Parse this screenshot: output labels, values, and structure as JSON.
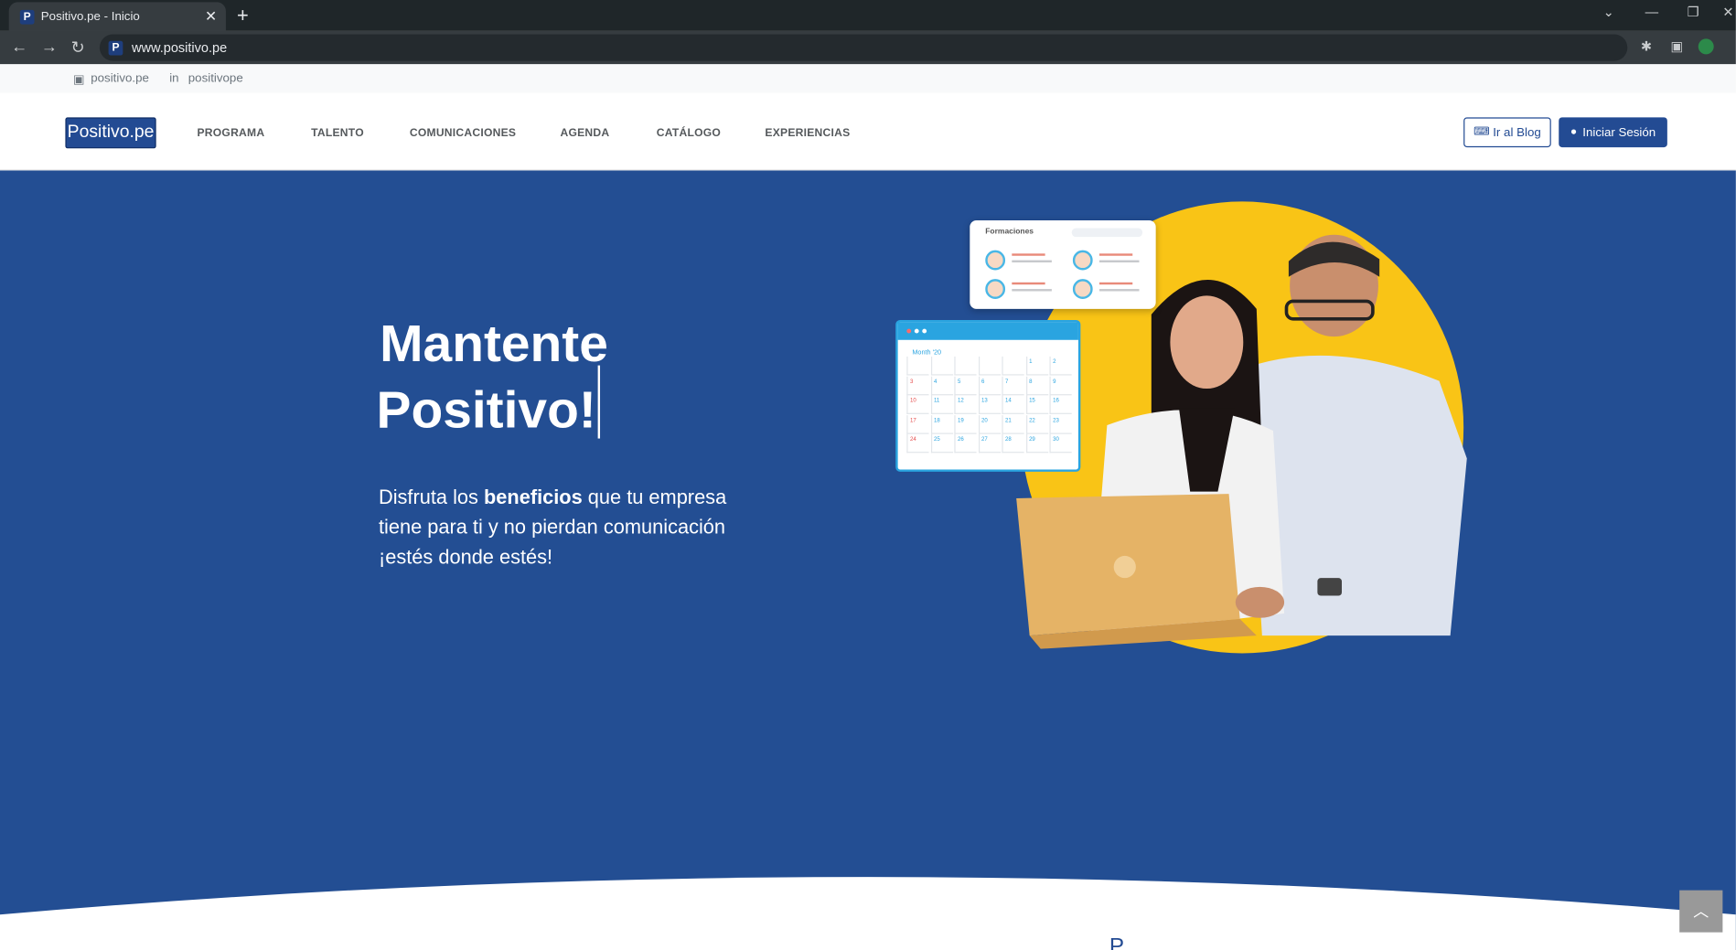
{
  "browser": {
    "tab_title": "Positivo.pe - Inicio",
    "tab_close": "✕",
    "new_tab": "+",
    "favicon": "P",
    "url": "www.positivo.pe",
    "icons": [
      "back-icon",
      "forward-icon",
      "reload-icon",
      "extensions-icon",
      "side-panel-icon",
      "profile-icon"
    ]
  },
  "social": {
    "facebook": "positivo.pe",
    "linkedin": "positivope"
  },
  "header": {
    "logo": "Positivo.pe",
    "menu": [
      "PROGRAMA",
      "TALENTO",
      "COMUNICACIONES",
      "AGENDA",
      "CATÁLOGO",
      "EXPERIENCIAS"
    ],
    "blog_button": "Ir al Blog",
    "login_button": "Iniciar Sesión"
  },
  "hero": {
    "title_line1": "Mantente",
    "title_line2": "Positivo!",
    "text_pre": "Disfruta los ",
    "text_bold": "beneficios",
    "text_post": " que tu empresa tiene para ti y no pierdan comunicación ¡estés donde estés!",
    "illustration": {
      "card_title": "Formaciones",
      "calendar_label": "Month '20",
      "calendar_days": [
        "",
        "",
        "",
        "",
        "",
        "1",
        "2",
        "3",
        "4",
        "5",
        "6",
        "7",
        "8",
        "9",
        "10",
        "11",
        "12",
        "13",
        "14",
        "15",
        "16",
        "17",
        "18",
        "19",
        "20",
        "21",
        "22",
        "23",
        "24",
        "25",
        "26",
        "27",
        "28",
        "29",
        "30"
      ]
    }
  },
  "next_section_peek": "P",
  "colors": {
    "brand": "#234b93",
    "hero_bg": "#234e93",
    "accent_yellow": "#f9c416",
    "calendar_blue": "#2aa4e0"
  }
}
